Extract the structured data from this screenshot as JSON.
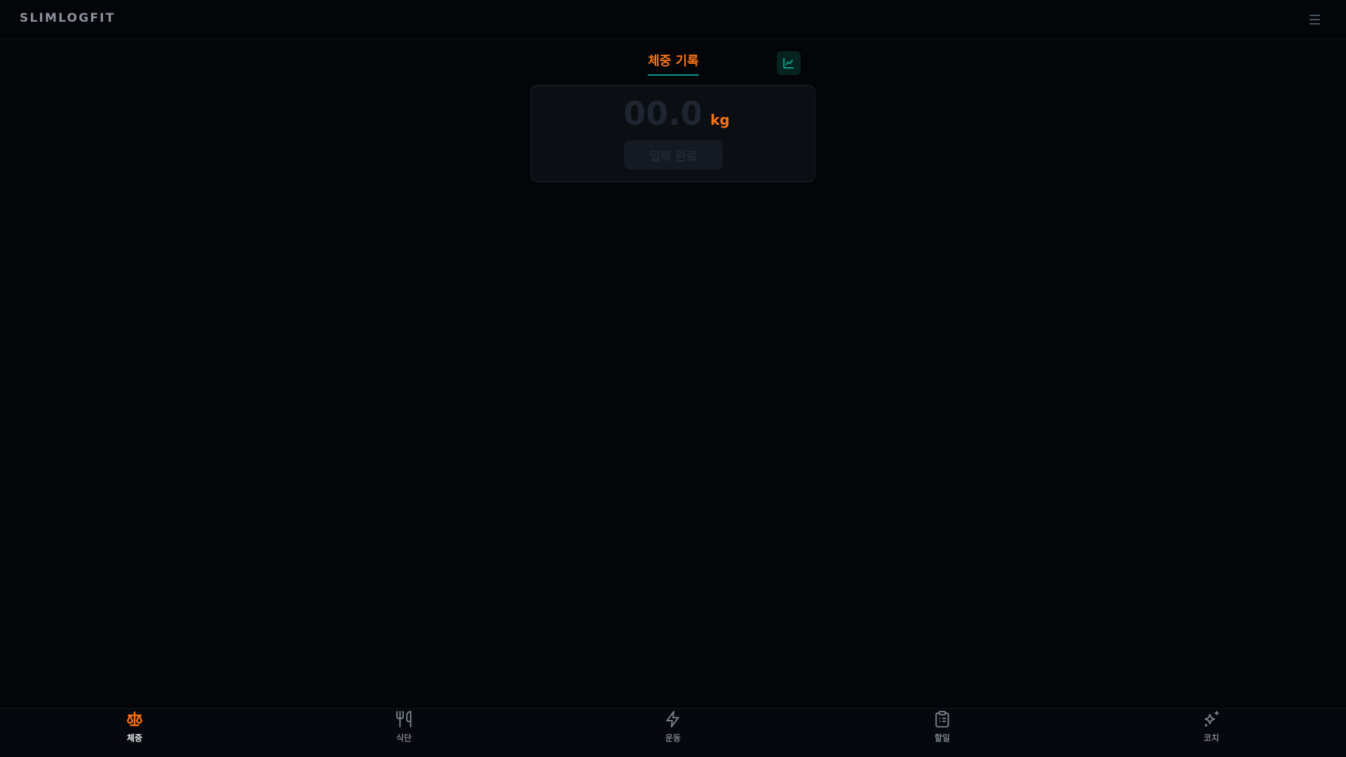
{
  "header": {
    "brand": "SLIMLOGFIT",
    "menu_icon": "menu-icon"
  },
  "main": {
    "tab_title": "체중 기록",
    "chart_button_icon": "line-chart-icon",
    "weight_card": {
      "placeholder": "00.0",
      "unit": "kg",
      "submit_label": "입력 완료"
    }
  },
  "nav": {
    "items": [
      {
        "label": "체중",
        "icon": "scale-icon",
        "active": true
      },
      {
        "label": "식단",
        "icon": "utensils-icon",
        "active": false
      },
      {
        "label": "운동",
        "icon": "lightning-icon",
        "active": false
      },
      {
        "label": "할일",
        "icon": "clipboard-icon",
        "active": false
      },
      {
        "label": "코치",
        "icon": "sparkles-icon",
        "active": false
      }
    ]
  },
  "colors": {
    "background": "#030508",
    "accent": "#f97316",
    "teal": "#0d9488",
    "muted": "#7a818b"
  }
}
